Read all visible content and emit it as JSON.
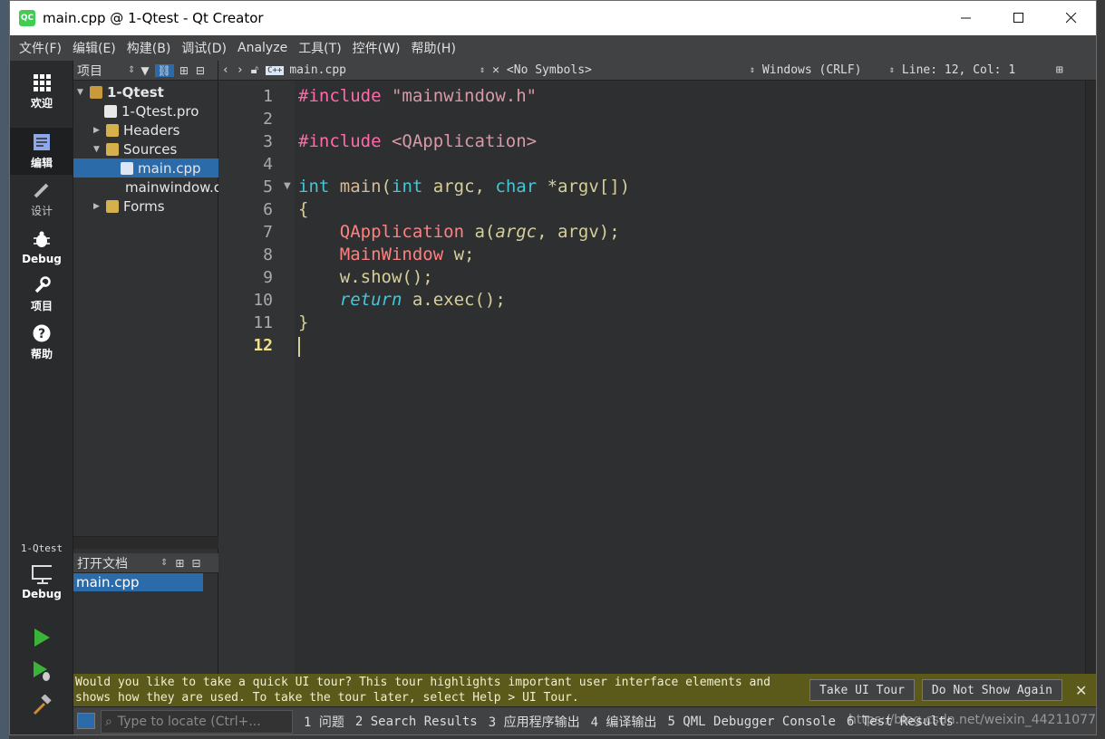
{
  "window": {
    "title": "main.cpp @ 1-Qtest - Qt Creator",
    "logo": "QC"
  },
  "menu": [
    "文件(F)",
    "编辑(E)",
    "构建(B)",
    "调试(D)",
    "Analyze",
    "工具(T)",
    "控件(W)",
    "帮助(H)"
  ],
  "modes": {
    "welcome": "欢迎",
    "edit": "编辑",
    "design": "设计",
    "debug": "Debug",
    "projects": "项目",
    "help": "帮助",
    "target_project": "1-Qtest",
    "target_build": "Debug"
  },
  "project_panel": {
    "selector": "项目",
    "tree": [
      {
        "label": "1-Qtest",
        "icon": "project-icon"
      },
      {
        "label": "1-Qtest.pro",
        "icon": "pro-file-icon"
      },
      {
        "label": "Headers",
        "icon": "folder-icon"
      },
      {
        "label": "Sources",
        "icon": "folder-icon"
      },
      {
        "label": "main.cpp",
        "icon": "cpp-file-icon"
      },
      {
        "label": "mainwindow.cpp",
        "icon": "cpp-file-icon"
      },
      {
        "label": "Forms",
        "icon": "folder-icon"
      }
    ]
  },
  "open_docs": {
    "title": "打开文档",
    "items": [
      "main.cpp"
    ]
  },
  "editor_toolbar": {
    "file": "main.cpp",
    "symbols": "<No Symbols>",
    "line_ending": "Windows (CRLF)",
    "position": "Line: 12, Col: 1"
  },
  "editor": {
    "line_numbers": [
      "1",
      "2",
      "3",
      "4",
      "5",
      "6",
      "7",
      "8",
      "9",
      "10",
      "11",
      "12"
    ],
    "current_line": "12"
  },
  "infobar": {
    "message": "Would you like to take a quick UI tour? This tour highlights important user interface elements and shows how they are used. To take the tour later, select Help > UI Tour.",
    "take_tour": "Take UI Tour",
    "dont_show": "Do Not Show Again"
  },
  "bottom": {
    "locator_placeholder": "Type to locate (Ctrl+...",
    "tabs": [
      "1 问题",
      "2 Search Results",
      "3 应用程序输出",
      "4 编译输出",
      "5 QML Debugger Console",
      "6 Test Results"
    ],
    "watermark": "https://blog.csdn.net/weixin_44211077"
  },
  "colors": {
    "accent": "#2c6baa",
    "qt_green": "#41cd52",
    "infobar": "#5c5a1a"
  }
}
